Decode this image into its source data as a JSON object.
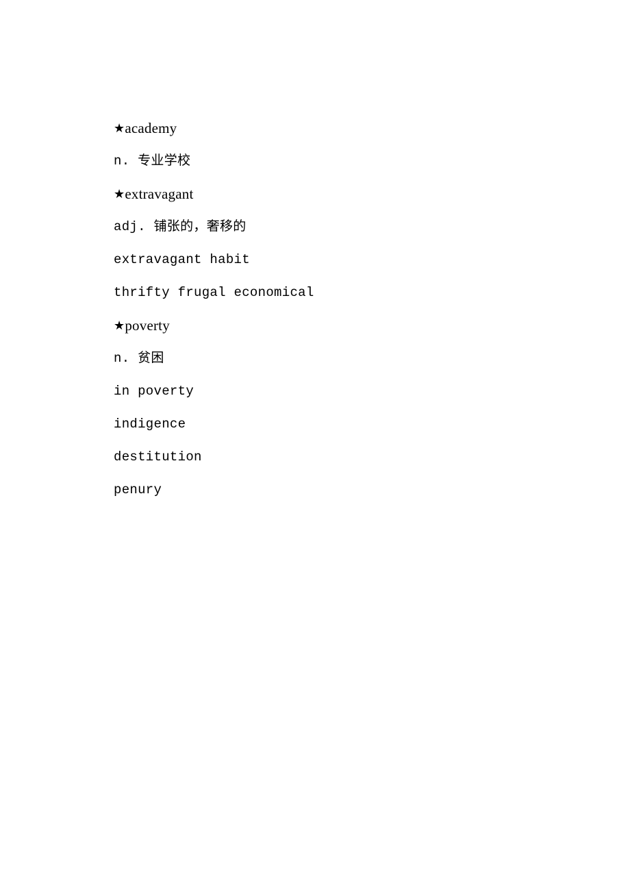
{
  "document": {
    "background_color": "#ffffff",
    "text_color": "#000000",
    "star_glyph": "★"
  },
  "entries": [
    {
      "headword": "academy",
      "star": "★",
      "lines": [
        {
          "text": "n. 专业学校",
          "style": "body"
        }
      ]
    },
    {
      "headword": "extravagant",
      "star": "★",
      "lines": [
        {
          "text": "adj. 铺张的，奢移的",
          "style": "body"
        },
        {
          "text": "extravagant habit",
          "style": "body"
        },
        {
          "text": "thrifty frugal economical",
          "style": "body"
        }
      ]
    },
    {
      "headword": "poverty",
      "star": "★",
      "lines": [
        {
          "text": "n. 贫困",
          "style": "body"
        },
        {
          "text": "in poverty",
          "style": "body"
        },
        {
          "text": "indigence",
          "style": "body"
        },
        {
          "text": "destitution",
          "style": "body"
        },
        {
          "text": "penury",
          "style": "body"
        }
      ]
    }
  ],
  "flat_lines": [
    {
      "kind": "headword",
      "star": "★",
      "text": "academy"
    },
    {
      "kind": "body",
      "text": "n. 专业学校"
    },
    {
      "kind": "headword",
      "star": "★",
      "text": "extravagant"
    },
    {
      "kind": "body",
      "text": "adj. 铺张的，奢移的"
    },
    {
      "kind": "body",
      "text": "extravagant habit"
    },
    {
      "kind": "body",
      "text": "thrifty frugal economical"
    },
    {
      "kind": "headword",
      "star": "★",
      "text": "poverty"
    },
    {
      "kind": "body",
      "text": "n. 贫困"
    },
    {
      "kind": "body",
      "text": "in poverty"
    },
    {
      "kind": "body",
      "text": "indigence"
    },
    {
      "kind": "body",
      "text": "destitution"
    },
    {
      "kind": "body",
      "text": "penury"
    }
  ]
}
